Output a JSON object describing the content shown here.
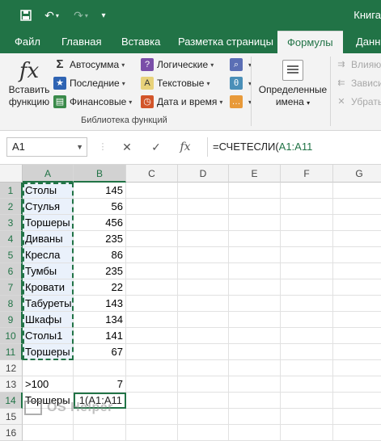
{
  "title_bar": {
    "title": "Книга",
    "save_icon": "save-icon",
    "undo_icon": "undo-icon",
    "redo_icon": "redo-icon",
    "customize_icon": "chevron-down-icon"
  },
  "tabs": [
    {
      "label": "Файл",
      "active": false
    },
    {
      "label": "Главная",
      "active": false
    },
    {
      "label": "Вставка",
      "active": false
    },
    {
      "label": "Разметка страницы",
      "active": false
    },
    {
      "label": "Формулы",
      "active": true
    },
    {
      "label": "Данны",
      "active": false
    }
  ],
  "ribbon": {
    "insert_function": {
      "line1": "Вставить",
      "line2": "функцию",
      "icon": "fx"
    },
    "autosum": "Автосумма",
    "recent": "Последние",
    "financial": "Финансовые",
    "logical": "Логические",
    "text": "Текстовые",
    "datetime": "Дата и время",
    "group_label": "Библиотека функций",
    "defined_names": {
      "line1": "Определенные",
      "line2": "имена"
    },
    "trace_precedents": "Влияю",
    "trace_dependents": "Зависи",
    "remove_arrows": "Убрать"
  },
  "formula_bar": {
    "name_box": "A1",
    "fx_label": "fx",
    "formula_text": "=СЧЕТЕСЛИ(",
    "formula_ref": "A1:A11"
  },
  "columns": [
    "A",
    "B",
    "C",
    "D",
    "E",
    "F",
    "G"
  ],
  "rows": [
    {
      "n": "1",
      "a": "Столы",
      "b": "145"
    },
    {
      "n": "2",
      "a": "Стулья",
      "b": "56"
    },
    {
      "n": "3",
      "a": "Торшеры",
      "b": "456"
    },
    {
      "n": "4",
      "a": "Диваны",
      "b": "235"
    },
    {
      "n": "5",
      "a": "Кресла",
      "b": "86"
    },
    {
      "n": "6",
      "a": "Тумбы",
      "b": "235"
    },
    {
      "n": "7",
      "a": "Кровати",
      "b": "22"
    },
    {
      "n": "8",
      "a": "Табуреты",
      "b": "143"
    },
    {
      "n": "9",
      "a": "Шкафы",
      "b": "134"
    },
    {
      "n": "10",
      "a": "Столы1",
      "b": "141"
    },
    {
      "n": "11",
      "a": "Торшеры",
      "b": "67"
    },
    {
      "n": "12",
      "a": "",
      "b": ""
    },
    {
      "n": "13",
      "a": ">100",
      "b": "7"
    },
    {
      "n": "14",
      "a": "Торшеры",
      "b": ""
    },
    {
      "n": "15",
      "a": "",
      "b": ""
    },
    {
      "n": "16",
      "a": "",
      "b": ""
    }
  ],
  "active_cell_text": "1(A1:A11",
  "watermark": "OS Helper",
  "colors": {
    "accent": "#217346",
    "selection_fill": "#eaf1fb"
  }
}
